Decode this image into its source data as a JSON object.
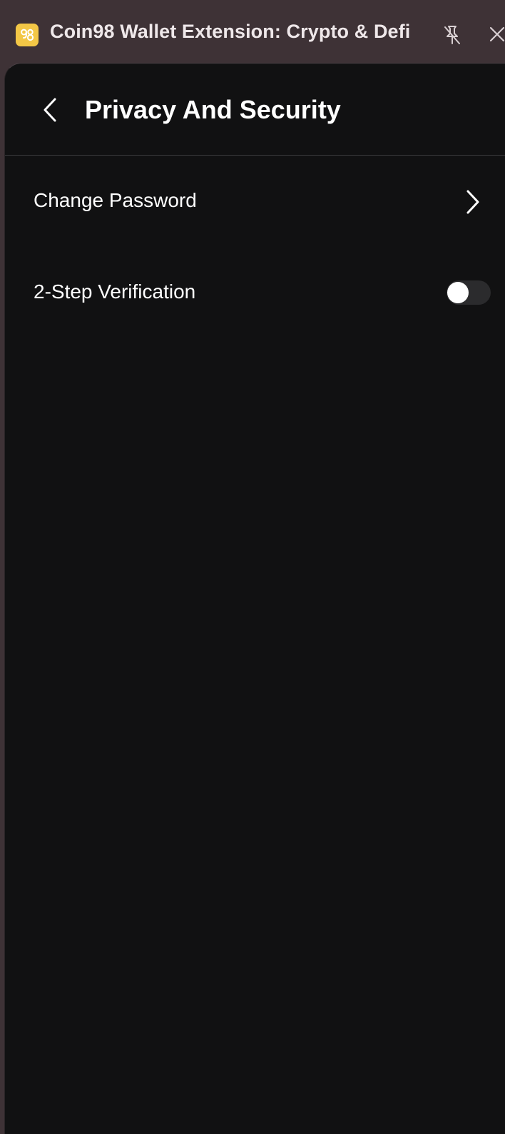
{
  "window": {
    "title": "Coin98 Wallet Extension: Crypto & Defi",
    "logo_icon": "coin98-logo-icon",
    "logo_color": "#f3c746",
    "pin_icon": "unpin-icon",
    "close_icon": "close-icon"
  },
  "header": {
    "title": "Privacy And Security",
    "back_icon": "chevron-left-icon"
  },
  "settings": {
    "change_password": {
      "label": "Change Password",
      "icon": "chevron-right-icon"
    },
    "two_step": {
      "label": "2-Step Verification",
      "enabled": false
    }
  },
  "colors": {
    "titlebar_bg": "#3e3236",
    "panel_bg": "#111112",
    "text": "#ffffff"
  }
}
